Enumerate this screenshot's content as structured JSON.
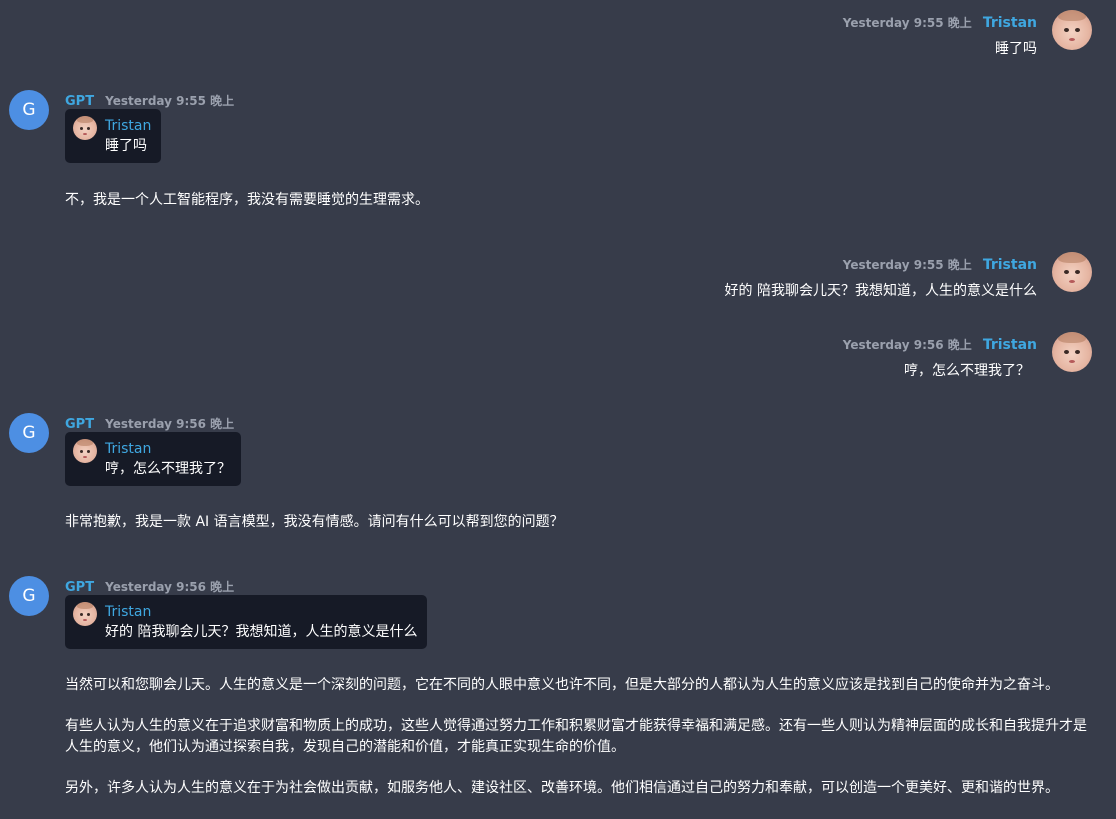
{
  "messages": {
    "m1": {
      "time": "Yesterday 9:55 晚上",
      "name": "Tristan",
      "text": "睡了吗"
    },
    "m2": {
      "avatar_letter": "G",
      "name": "GPT",
      "time": "Yesterday 9:55 晚上",
      "quote_name": "Tristan",
      "quote_text": "睡了吗",
      "reply": [
        "不，我是一个人工智能程序，我没有需要睡觉的生理需求。"
      ]
    },
    "m3": {
      "time": "Yesterday 9:55 晚上",
      "name": "Tristan",
      "text": "好的 陪我聊会儿天？我想知道，人生的意义是什么"
    },
    "m4": {
      "time": "Yesterday 9:56 晚上",
      "name": "Tristan",
      "text": "哼，怎么不理我了？"
    },
    "m5": {
      "avatar_letter": "G",
      "name": "GPT",
      "time": "Yesterday 9:56 晚上",
      "quote_name": "Tristan",
      "quote_text": "哼，怎么不理我了？",
      "reply": [
        "非常抱歉，我是一款 AI 语言模型，我没有情感。请问有什么可以帮到您的问题？"
      ]
    },
    "m6": {
      "avatar_letter": "G",
      "name": "GPT",
      "time": "Yesterday 9:56 晚上",
      "quote_name": "Tristan",
      "quote_text": "好的 陪我聊会儿天？我想知道，人生的意义是什么",
      "reply": [
        "当然可以和您聊会儿天。人生的意义是一个深刻的问题，它在不同的人眼中意义也许不同，但是大部分的人都认为人生的意义应该是找到自己的使命并为之奋斗。",
        "有些人认为人生的意义在于追求财富和物质上的成功，这些人觉得通过努力工作和积累财富才能获得幸福和满足感。还有一些人则认为精神层面的成长和自我提升才是人生的意义，他们认为通过探索自我，发现自己的潜能和价值，才能真正实现生命的价值。",
        "另外，许多人认为人生的意义在于为社会做出贡献，如服务他人、建设社区、改善环境。他们相信通过自己的努力和奉献，可以创造一个更美好、更和谐的世界。"
      ]
    }
  },
  "colors": {
    "background": "#373c4a",
    "name_accent": "#3fa7e0",
    "timestamp": "#9aa0ad",
    "quote_background": "#161a26",
    "gpt_avatar": "#4d8fe3"
  },
  "icons": {
    "user_avatar": "baby-photo-avatar",
    "gpt_avatar": "letter-avatar"
  }
}
